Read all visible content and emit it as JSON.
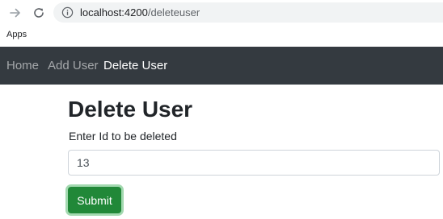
{
  "browser": {
    "url_host": "localhost:4200",
    "url_path": "/deleteuser",
    "bookmarks": {
      "apps_label": "Apps"
    }
  },
  "navbar": {
    "links": [
      {
        "label": "Home",
        "active": false
      },
      {
        "label": "Add User",
        "active": false
      },
      {
        "label": "Delete User",
        "active": true
      }
    ]
  },
  "main": {
    "title": "Delete User",
    "field_label": "Enter Id to be deleted",
    "id_value": "13",
    "submit_label": "Submit"
  },
  "colors": {
    "navbar_bg": "#343a40",
    "submit_bg": "#218838"
  }
}
